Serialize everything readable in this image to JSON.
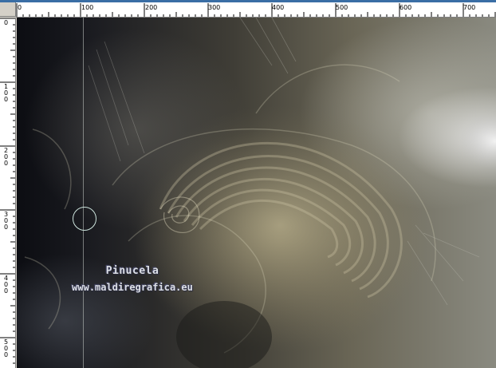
{
  "ruler": {
    "horizontal_labels": [
      "0",
      "100",
      "200",
      "300",
      "400",
      "500",
      "600",
      "700"
    ],
    "vertical_labels": [
      "0",
      "100",
      "200",
      "300",
      "400",
      "500"
    ]
  },
  "watermark": {
    "name": "Pinucela",
    "site": "www.maldiregrafica.eu"
  },
  "colors": {
    "window_edge": "#3a6ea5",
    "ruler_bg": "#ffffff",
    "frame_bg": "#d4d0c8",
    "cursor_ring": "#cde4dd"
  }
}
